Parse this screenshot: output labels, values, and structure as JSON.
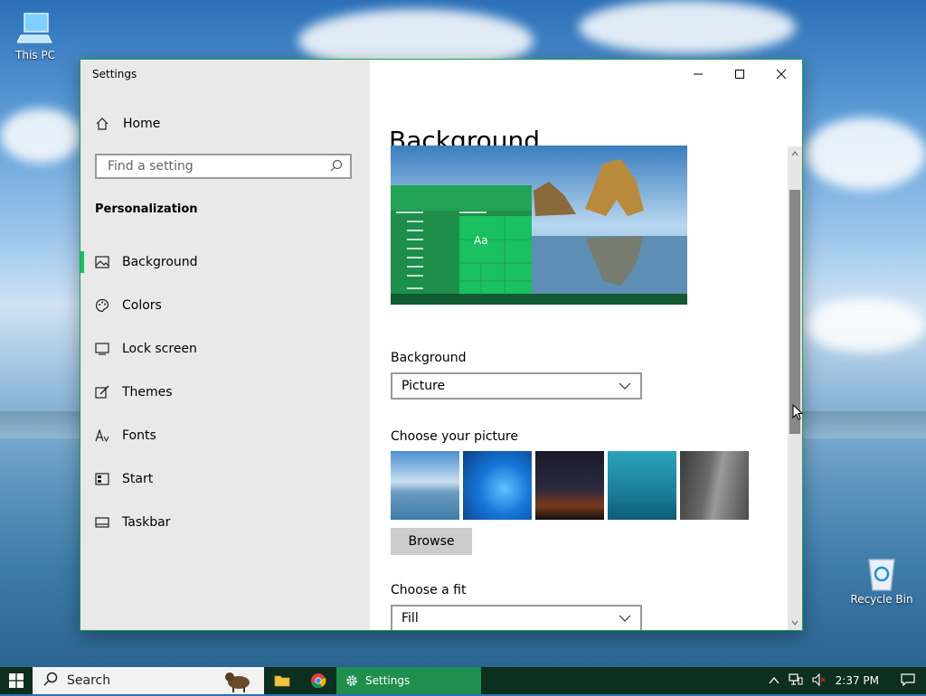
{
  "desktop": {
    "icons": [
      {
        "label": "This PC"
      },
      {
        "label": "Recycle Bin"
      }
    ]
  },
  "window": {
    "title": "Settings",
    "controls": {
      "minimize": "—",
      "maximize": "☐",
      "close": "✕"
    }
  },
  "sidebar": {
    "home_label": "Home",
    "search_placeholder": "Find a setting",
    "section_title": "Personalization",
    "items": [
      {
        "label": "Background",
        "icon": "image-icon",
        "active": true
      },
      {
        "label": "Colors",
        "icon": "palette-icon"
      },
      {
        "label": "Lock screen",
        "icon": "lock-screen-icon"
      },
      {
        "label": "Themes",
        "icon": "themes-icon"
      },
      {
        "label": "Fonts",
        "icon": "fonts-icon"
      },
      {
        "label": "Start",
        "icon": "start-icon"
      },
      {
        "label": "Taskbar",
        "icon": "taskbar-icon"
      }
    ]
  },
  "main": {
    "title": "Background",
    "preview": {
      "sample_text": "Aa"
    },
    "background_label": "Background",
    "background_value": "Picture",
    "choose_picture_label": "Choose your picture",
    "browse_label": "Browse",
    "choose_fit_label": "Choose a fit",
    "fit_value": "Fill"
  },
  "taskbar": {
    "search_label": "Search",
    "settings_label": "Settings",
    "time": "2:37 PM"
  },
  "colors": {
    "accent": "#19c160",
    "taskbar": "#0d2f1f",
    "active_task": "#1f8f4f"
  }
}
